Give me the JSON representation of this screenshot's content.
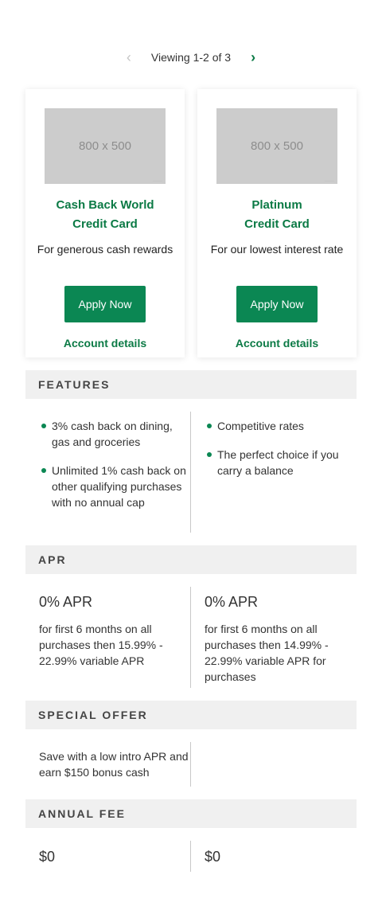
{
  "pager": {
    "label": "Viewing 1-2 of 3",
    "prev_icon": "chevron-left-icon",
    "next_icon": "chevron-right-icon"
  },
  "colors": {
    "accent": "#0b7a45",
    "button": "#0b8753",
    "band": "#f0f0f0",
    "placeholder": "#cccccc"
  },
  "cards": [
    {
      "image_label": "800 x 500",
      "name_line1": "Cash Back World",
      "name_line2": "Credit Card",
      "tagline": "For generous cash rewards",
      "apply": "Apply Now",
      "details": "Account details"
    },
    {
      "image_label": "800 x 500",
      "name_line1": "Platinum",
      "name_line2": "Credit Card",
      "tagline": "For our lowest interest rate",
      "apply": "Apply Now",
      "details": "Account details"
    }
  ],
  "sections": {
    "features": {
      "title": "FEATURES",
      "left": [
        "3% cash back on dining, gas and groceries",
        "Unlimited 1% cash back on other qualifying purchases with no annual cap"
      ],
      "right": [
        "Competitive rates",
        "The perfect choice if you carry a balance"
      ]
    },
    "apr": {
      "title": "APR",
      "left": {
        "headline": "0% APR",
        "text": "for first 6 months on all purchases then 15.99% - 22.99% variable APR"
      },
      "right": {
        "headline": "0% APR",
        "text": "for first 6 months on all purchases then 14.99% - 22.99% variable APR for purchases"
      }
    },
    "special_offer": {
      "title": "SPECIAL OFFER",
      "left": "Save with a low intro APR and earn $150 bonus cash",
      "right": ""
    },
    "annual_fee": {
      "title": "ANNUAL FEE",
      "left": "$0",
      "right": "$0"
    }
  }
}
